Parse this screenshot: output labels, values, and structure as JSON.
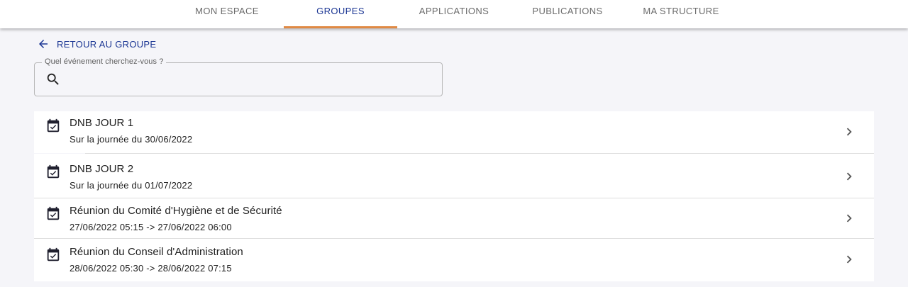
{
  "nav": {
    "tabs": [
      {
        "label": "MON ESPACE"
      },
      {
        "label": "GROUPES"
      },
      {
        "label": "APPLICATIONS"
      },
      {
        "label": "PUBLICATIONS"
      },
      {
        "label": "MA STRUCTURE"
      }
    ],
    "active_tab": "GROUPES"
  },
  "back_link": {
    "label": "RETOUR AU GROUPE",
    "icon": "arrow-left-icon"
  },
  "search": {
    "label": "Quel événement cherchez-vous ?",
    "value": "",
    "icon": "search-icon"
  },
  "events": [
    {
      "title": "DNB JOUR 1",
      "subtitle": "Sur la journée du 30/06/2022",
      "icon": "calendar-check-icon"
    },
    {
      "title": "DNB JOUR 2",
      "subtitle": "Sur la journée du 01/07/2022",
      "icon": "calendar-check-icon"
    },
    {
      "title": "Réunion du Comité d'Hygiène et de Sécurité",
      "subtitle": "27/06/2022 05:15 -> 27/06/2022 06:00",
      "icon": "calendar-check-icon"
    },
    {
      "title": "Réunion du Conseil d'Administration",
      "subtitle": "28/06/2022 05:30 -> 28/06/2022 07:15",
      "icon": "calendar-check-icon"
    }
  ],
  "colors": {
    "accent": "#1a3593",
    "tab_indicator": "#e08a44",
    "background": "#f5f5f9"
  }
}
